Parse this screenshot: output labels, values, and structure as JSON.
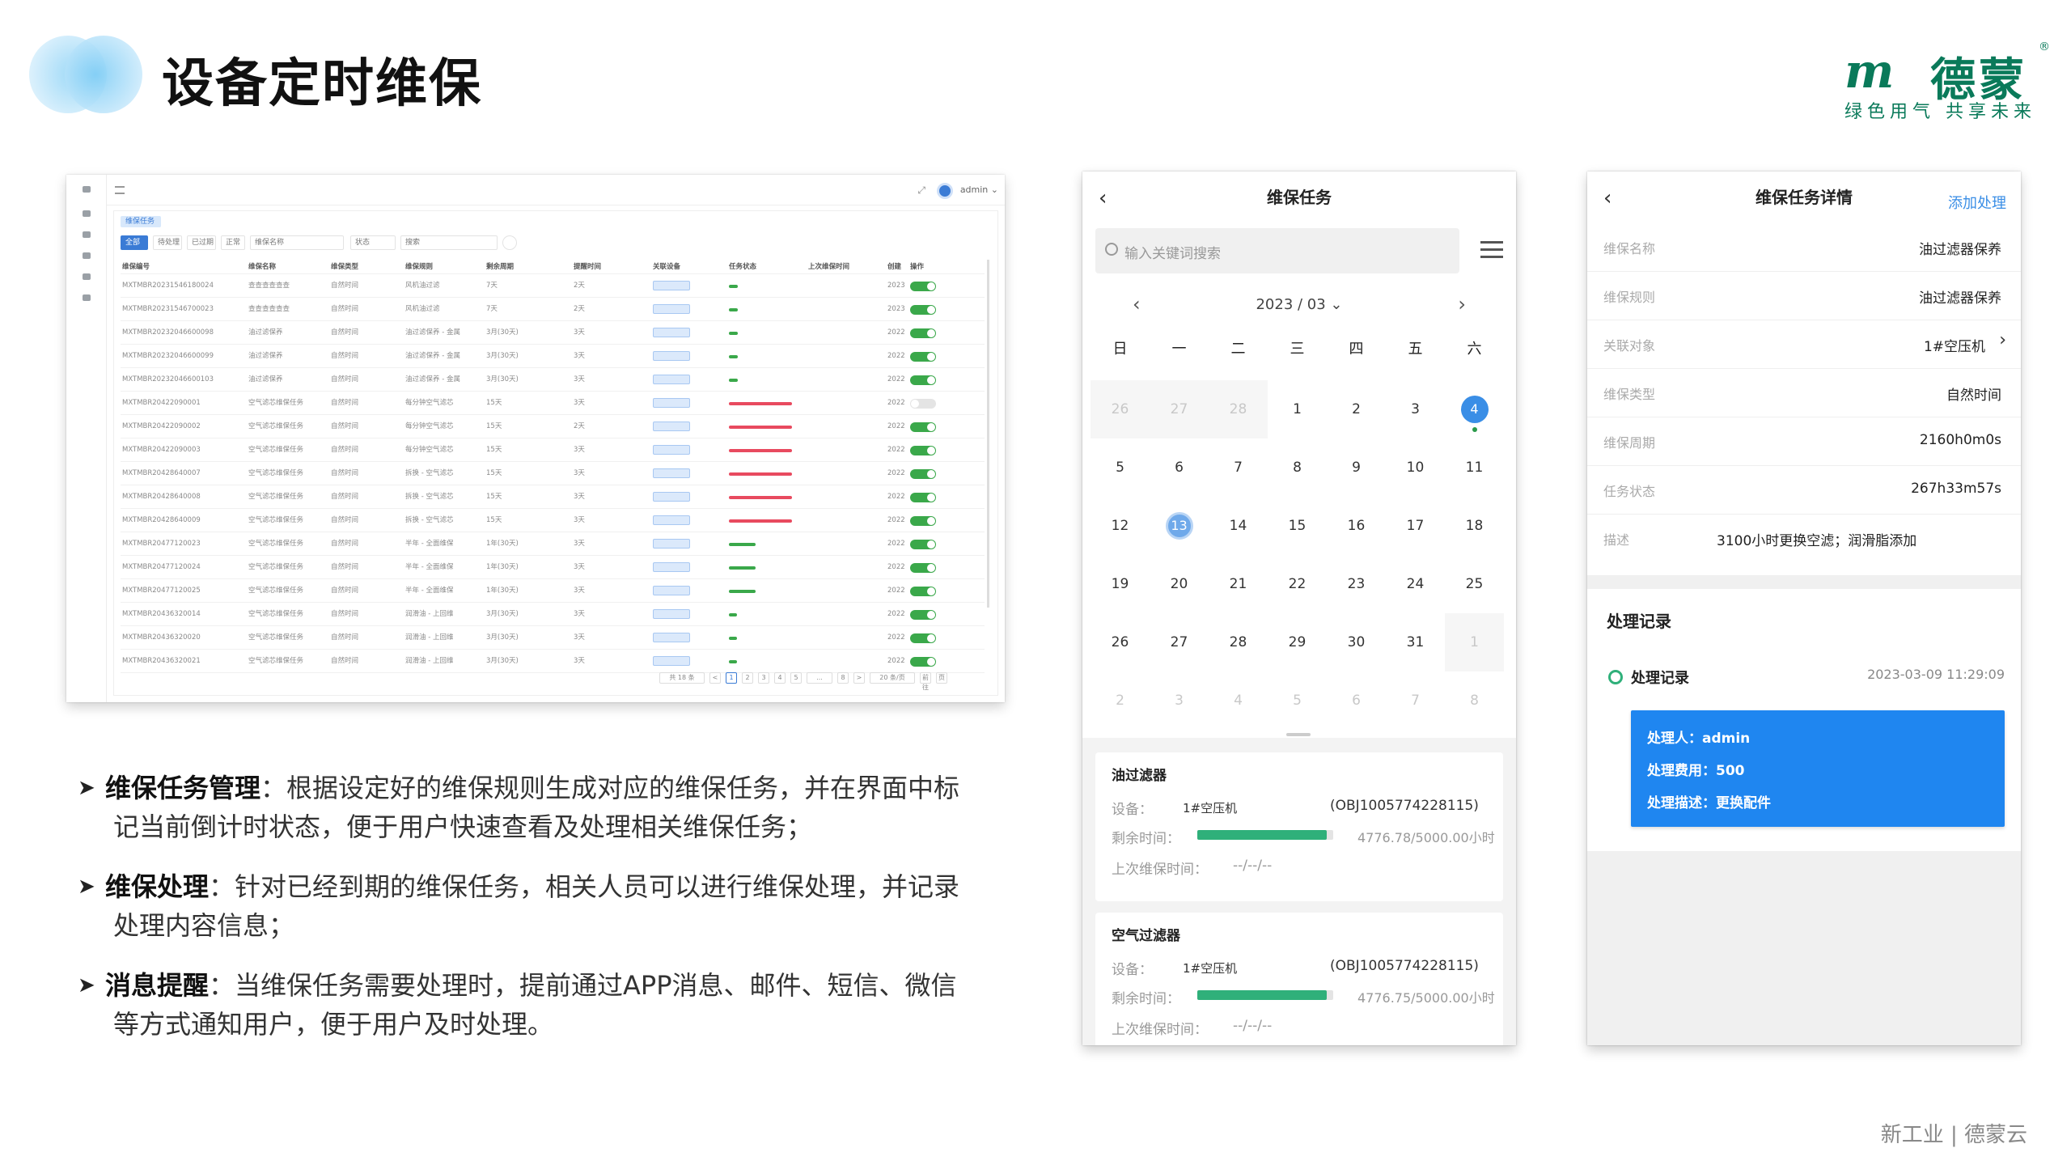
{
  "header": {
    "title": "设备定时维保",
    "brand_mark": "m",
    "brand_name": "德蒙",
    "brand_reg": "®",
    "brand_slogan": "绿色用气 共享未来"
  },
  "desktop": {
    "tab": "维保任务",
    "user": "admin ⌄",
    "filters": [
      "全部",
      "待处理",
      "已过期",
      "正常",
      "维保名称",
      "状态",
      "搜索"
    ],
    "columns": [
      "维保编号",
      "维保名称",
      "维保类型",
      "维保规则",
      "剩余周期",
      "提醒时间",
      "关联设备",
      "任务状态",
      "上次维保时间",
      "创建",
      "操作"
    ],
    "rows": [
      {
        "id": "MXTMBR20231546180024",
        "name": "查查查查查查",
        "type": "自然时间",
        "rule": "风机油过滤",
        "period": "7天",
        "remind": "2天",
        "bar": "green",
        "pct": 0.18,
        "year": "2023",
        "on": true
      },
      {
        "id": "MXTMBR20231546700023",
        "name": "查查查查查查",
        "type": "自然时间",
        "rule": "风机油过滤",
        "period": "7天",
        "remind": "2天",
        "bar": "green",
        "pct": 0.18,
        "year": "2023",
        "on": true
      },
      {
        "id": "MXTMBR20232046600098",
        "name": "油过滤保养",
        "type": "自然时间",
        "rule": "油过滤保养 - 金属",
        "period": "3月(30天)",
        "remind": "3天",
        "bar": "green",
        "pct": 0.18,
        "year": "2022",
        "on": true
      },
      {
        "id": "MXTMBR20232046600099",
        "name": "油过滤保养",
        "type": "自然时间",
        "rule": "油过滤保养 - 金属",
        "period": "3月(30天)",
        "remind": "3天",
        "bar": "green",
        "pct": 0.18,
        "year": "2022",
        "on": true
      },
      {
        "id": "MXTMBR20232046600103",
        "name": "油过滤保养",
        "type": "自然时间",
        "rule": "油过滤保养 - 金属",
        "period": "3月(30天)",
        "remind": "3天",
        "bar": "green",
        "pct": 0.18,
        "year": "2022",
        "on": true
      },
      {
        "id": "MXTMBR20422090001",
        "name": "空气滤芯维保任务",
        "type": "自然时间",
        "rule": "每分钟空气滤芯",
        "period": "15天",
        "remind": "3天",
        "bar": "red",
        "pct": 1.0,
        "year": "2022",
        "on": false
      },
      {
        "id": "MXTMBR20422090002",
        "name": "空气滤芯维保任务",
        "type": "自然时间",
        "rule": "每分钟空气滤芯",
        "period": "15天",
        "remind": "2天",
        "bar": "red",
        "pct": 1.0,
        "year": "2022",
        "on": true
      },
      {
        "id": "MXTMBR20422090003",
        "name": "空气滤芯维保任务",
        "type": "自然时间",
        "rule": "每分钟空气滤芯",
        "period": "15天",
        "remind": "3天",
        "bar": "red",
        "pct": 1.0,
        "year": "2022",
        "on": true
      },
      {
        "id": "MXTMBR20428640007",
        "name": "空气滤芯维保任务",
        "type": "自然时间",
        "rule": "拆换 - 空气滤芯",
        "period": "15天",
        "remind": "3天",
        "bar": "red",
        "pct": 1.0,
        "year": "2022",
        "on": true
      },
      {
        "id": "MXTMBR20428640008",
        "name": "空气滤芯维保任务",
        "type": "自然时间",
        "rule": "拆换 - 空气滤芯",
        "period": "15天",
        "remind": "3天",
        "bar": "red",
        "pct": 1.0,
        "year": "2022",
        "on": true
      },
      {
        "id": "MXTMBR20428640009",
        "name": "空气滤芯维保任务",
        "type": "自然时间",
        "rule": "拆换 - 空气滤芯",
        "period": "15天",
        "remind": "3天",
        "bar": "red",
        "pct": 1.0,
        "year": "2022",
        "on": true
      },
      {
        "id": "MXTMBR20477120023",
        "name": "空气滤芯维保任务",
        "type": "自然时间",
        "rule": "半年 - 全面维保",
        "period": "1年(30天)",
        "remind": "3天",
        "bar": "green",
        "pct": 0.55,
        "year": "2022",
        "on": true
      },
      {
        "id": "MXTMBR20477120024",
        "name": "空气滤芯维保任务",
        "type": "自然时间",
        "rule": "半年 - 全面维保",
        "period": "1年(30天)",
        "remind": "3天",
        "bar": "green",
        "pct": 0.55,
        "year": "2022",
        "on": true
      },
      {
        "id": "MXTMBR20477120025",
        "name": "空气滤芯维保任务",
        "type": "自然时间",
        "rule": "半年 - 全面维保",
        "period": "1年(30天)",
        "remind": "3天",
        "bar": "green",
        "pct": 0.55,
        "year": "2022",
        "on": true
      },
      {
        "id": "MXTMBR20436320014",
        "name": "空气滤芯维保任务",
        "type": "自然时间",
        "rule": "润滑油 - 上回维",
        "period": "3月(30天)",
        "remind": "3天",
        "bar": "green",
        "pct": 0.0,
        "year": "2022",
        "on": true
      },
      {
        "id": "MXTMBR20436320020",
        "name": "空气滤芯维保任务",
        "type": "自然时间",
        "rule": "润滑油 - 上回维",
        "period": "3月(30天)",
        "remind": "3天",
        "bar": "green",
        "pct": 0.0,
        "year": "2022",
        "on": true
      },
      {
        "id": "MXTMBR20436320021",
        "name": "空气滤芯维保任务",
        "type": "自然时间",
        "rule": "润滑油 - 上回维",
        "period": "3月(30天)",
        "remind": "3天",
        "bar": "green",
        "pct": 0.0,
        "year": "2022",
        "on": true
      }
    ],
    "pager": [
      "共 18 条",
      "<",
      "1",
      "2",
      "3",
      "4",
      "5",
      "...",
      "8",
      ">",
      "20 条/页",
      "前往",
      "页"
    ]
  },
  "bullets": [
    {
      "head": "维保任务管理",
      "text": "：根据设定好的维保规则生成对应的维保任务，并在界面中标",
      "cont": "记当前倒计时状态，便于用户快速查看及处理相关维保任务；"
    },
    {
      "head": "维保处理",
      "text": "：针对已经到期的维保任务，相关人员可以进行维保处理，并记录",
      "cont": "处理内容信息；"
    },
    {
      "head": "消息提醒",
      "text": "：当维保任务需要处理时，提前通过APP消息、邮件、短信、微信",
      "cont": "等方式通知用户，便于用户及时处理。"
    }
  ],
  "phone1": {
    "title": "维保任务",
    "back": "‹",
    "search_placeholder": "输入关键词搜索",
    "month": "2023 / 03 ⌄",
    "prev": "‹",
    "next": "›",
    "weekdays": [
      "日",
      "一",
      "二",
      "三",
      "四",
      "五",
      "六"
    ],
    "weeks": [
      [
        "26",
        "27",
        "28",
        "1",
        "2",
        "3",
        "4"
      ],
      [
        "5",
        "6",
        "7",
        "8",
        "9",
        "10",
        "11"
      ],
      [
        "12",
        "13",
        "14",
        "15",
        "16",
        "17",
        "18"
      ],
      [
        "19",
        "20",
        "21",
        "22",
        "23",
        "24",
        "25"
      ],
      [
        "26",
        "27",
        "28",
        "29",
        "30",
        "31",
        "1"
      ],
      [
        "2",
        "3",
        "4",
        "5",
        "6",
        "7",
        "8"
      ]
    ],
    "cards": [
      {
        "title": "油过滤器",
        "device_label": "设备：",
        "device": "1#空压机",
        "obj": "(OBJ1005774228115)",
        "remain_label": "剩余时间：",
        "remain": "4776.78/5000.00小时",
        "remain_pct": 0.955,
        "last_label": "上次维保时间：",
        "last": "--/--/--"
      },
      {
        "title": "空气过滤器",
        "device_label": "设备：",
        "device": "1#空压机",
        "obj": "(OBJ1005774228115)",
        "remain_label": "剩余时间：",
        "remain": "4776.75/5000.00小时",
        "remain_pct": 0.955,
        "last_label": "上次维保时间：",
        "last": "--/--/--"
      }
    ]
  },
  "phone2": {
    "title": "维保任务详情",
    "back": "‹",
    "action": "添加处理",
    "fields": [
      {
        "k": "维保名称",
        "v": "油过滤器保养"
      },
      {
        "k": "维保规则",
        "v": "油过滤器保养"
      },
      {
        "k": "关联对象",
        "v": "1#空压机"
      },
      {
        "k": "维保类型",
        "v": "自然时间"
      },
      {
        "k": "维保周期",
        "v": "2160h0m0s"
      },
      {
        "k": "任务状态",
        "v": "267h33m57s"
      },
      {
        "k": "描述",
        "v": "3100小时更换空滤；润滑脂添加"
      }
    ],
    "record_section": "处理记录",
    "record_title": "处理记录",
    "record_time": "2023-03-09 11:29:09",
    "record_lines": [
      "处理人：admin",
      "处理费用：500",
      "处理描述：更换配件"
    ]
  },
  "footer": "新工业 | 德蒙云",
  "colors": {
    "brand": "#0a7a5a",
    "accent": "#1f86f0",
    "alert": "#e84a5f",
    "ok": "#2fb07a"
  }
}
